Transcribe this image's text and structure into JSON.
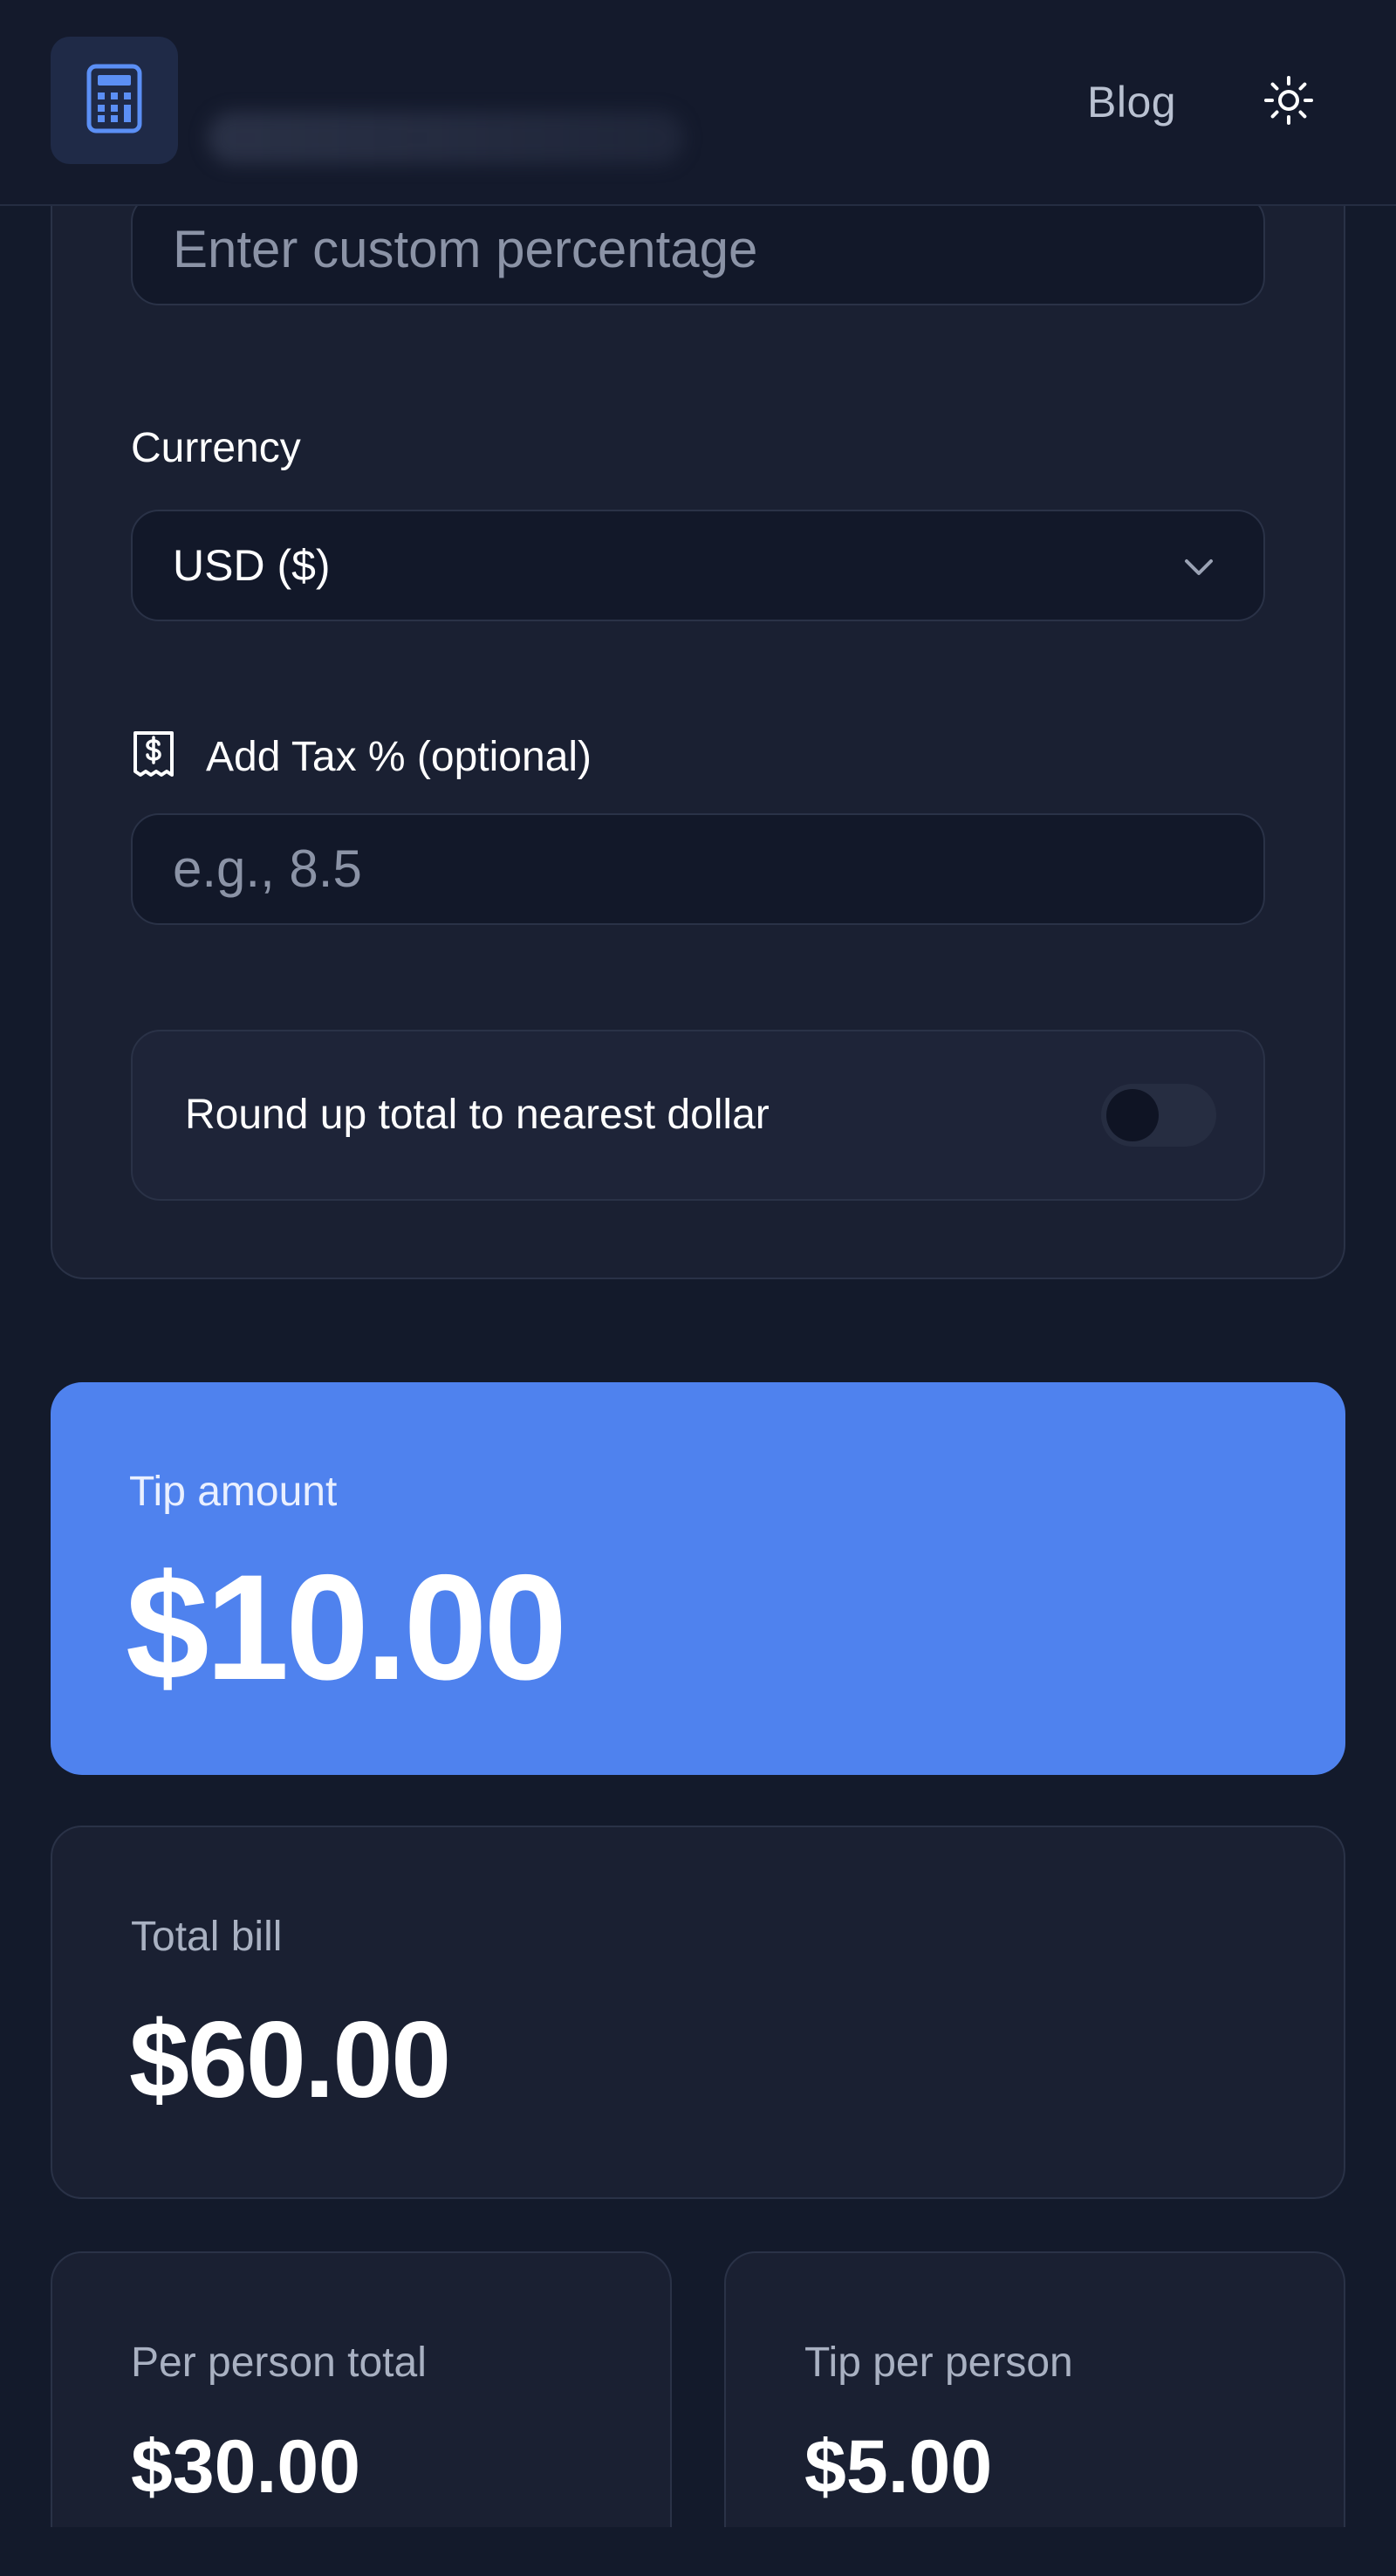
{
  "header": {
    "logo_icon": "calculator-icon",
    "blog_label": "Blog",
    "theme_icon": "sun-icon"
  },
  "form": {
    "custom_percentage": {
      "placeholder": "Enter custom percentage",
      "value": ""
    },
    "currency": {
      "label": "Currency",
      "selected": "USD ($)",
      "icon": "chevron-down-icon"
    },
    "tax": {
      "icon": "receipt-icon",
      "label": "Add Tax % (optional)",
      "placeholder": "e.g., 8.5",
      "value": ""
    },
    "round_up": {
      "label": "Round up total to nearest dollar",
      "enabled": false
    }
  },
  "results": {
    "tip_amount": {
      "label": "Tip amount",
      "value": "$10.00"
    },
    "total_bill": {
      "label": "Total bill",
      "value": "$60.00"
    },
    "per_person_total": {
      "label": "Per person total",
      "value": "$30.00"
    },
    "tip_per_person": {
      "label": "Tip per person",
      "value": "$5.00"
    }
  },
  "colors": {
    "background": "#131a2b",
    "card": "#1a2032",
    "accent": "#4f82ee",
    "icon_accent": "#5b8ff5"
  }
}
